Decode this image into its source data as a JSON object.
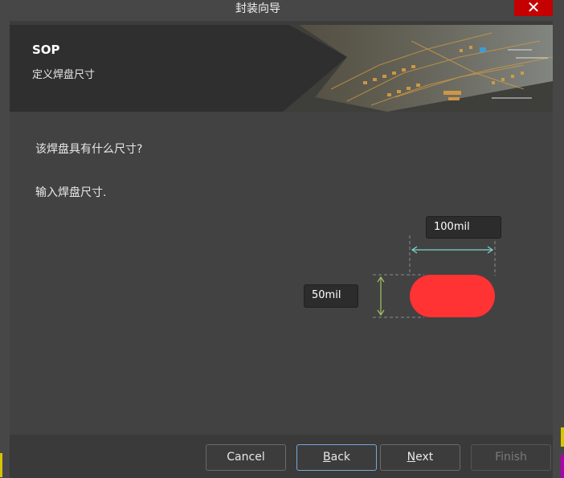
{
  "window": {
    "title": "封装向导",
    "close_glyph": "✕"
  },
  "banner": {
    "title": "SOP",
    "subtitle": "定义焊盘尺寸"
  },
  "content": {
    "question": "该焊盘具有什么尺寸?",
    "instruction": "输入焊盘尺寸."
  },
  "pad": {
    "width_value": "100mil",
    "height_value": "50mil",
    "pad_color": "#ff3333",
    "width_arrow_color": "#7fd4d0",
    "height_arrow_color": "#a8c060"
  },
  "buttons": {
    "cancel": "Cancel",
    "back_mnemonic": "B",
    "back_rest": "ack",
    "next_mnemonic": "N",
    "next_rest": "ext",
    "finish": "Finish"
  },
  "icons": {
    "close": "close-icon",
    "banner_art": "pcb-board-art"
  }
}
